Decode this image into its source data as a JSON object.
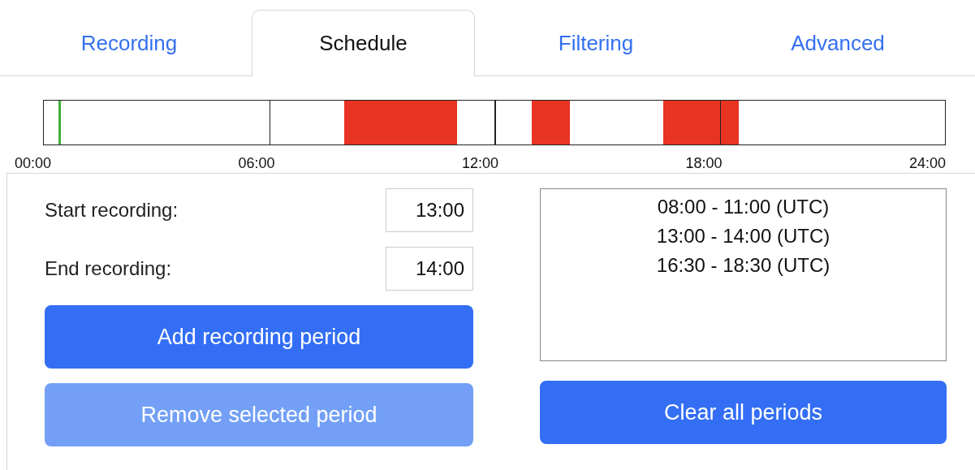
{
  "tabs": [
    {
      "label": "Recording",
      "selected": false
    },
    {
      "label": "Schedule",
      "selected": true
    },
    {
      "label": "Filtering",
      "selected": false
    },
    {
      "label": "Advanced",
      "selected": false
    }
  ],
  "timeline": {
    "ticks": [
      "00:00",
      "06:00",
      "12:00",
      "18:00",
      "24:00"
    ],
    "current_time": {
      "level": 0.016
    }
  },
  "form": {
    "fields": [
      {
        "label": "Start recording:",
        "value": "13:00"
      },
      {
        "label": "End recording:",
        "value": "14:00"
      }
    ],
    "buttons": [
      {
        "label": "Add recording period",
        "disabled": false
      },
      {
        "label": "Remove selected period",
        "disabled": true
      }
    ]
  },
  "periods": {
    "items": [
      "08:00 - 11:00 (UTC)",
      "13:00 - 14:00 (UTC)",
      "16:30 - 18:30 (UTC)"
    ],
    "clear_button": {
      "label": "Clear all periods",
      "disabled": false
    }
  }
}
